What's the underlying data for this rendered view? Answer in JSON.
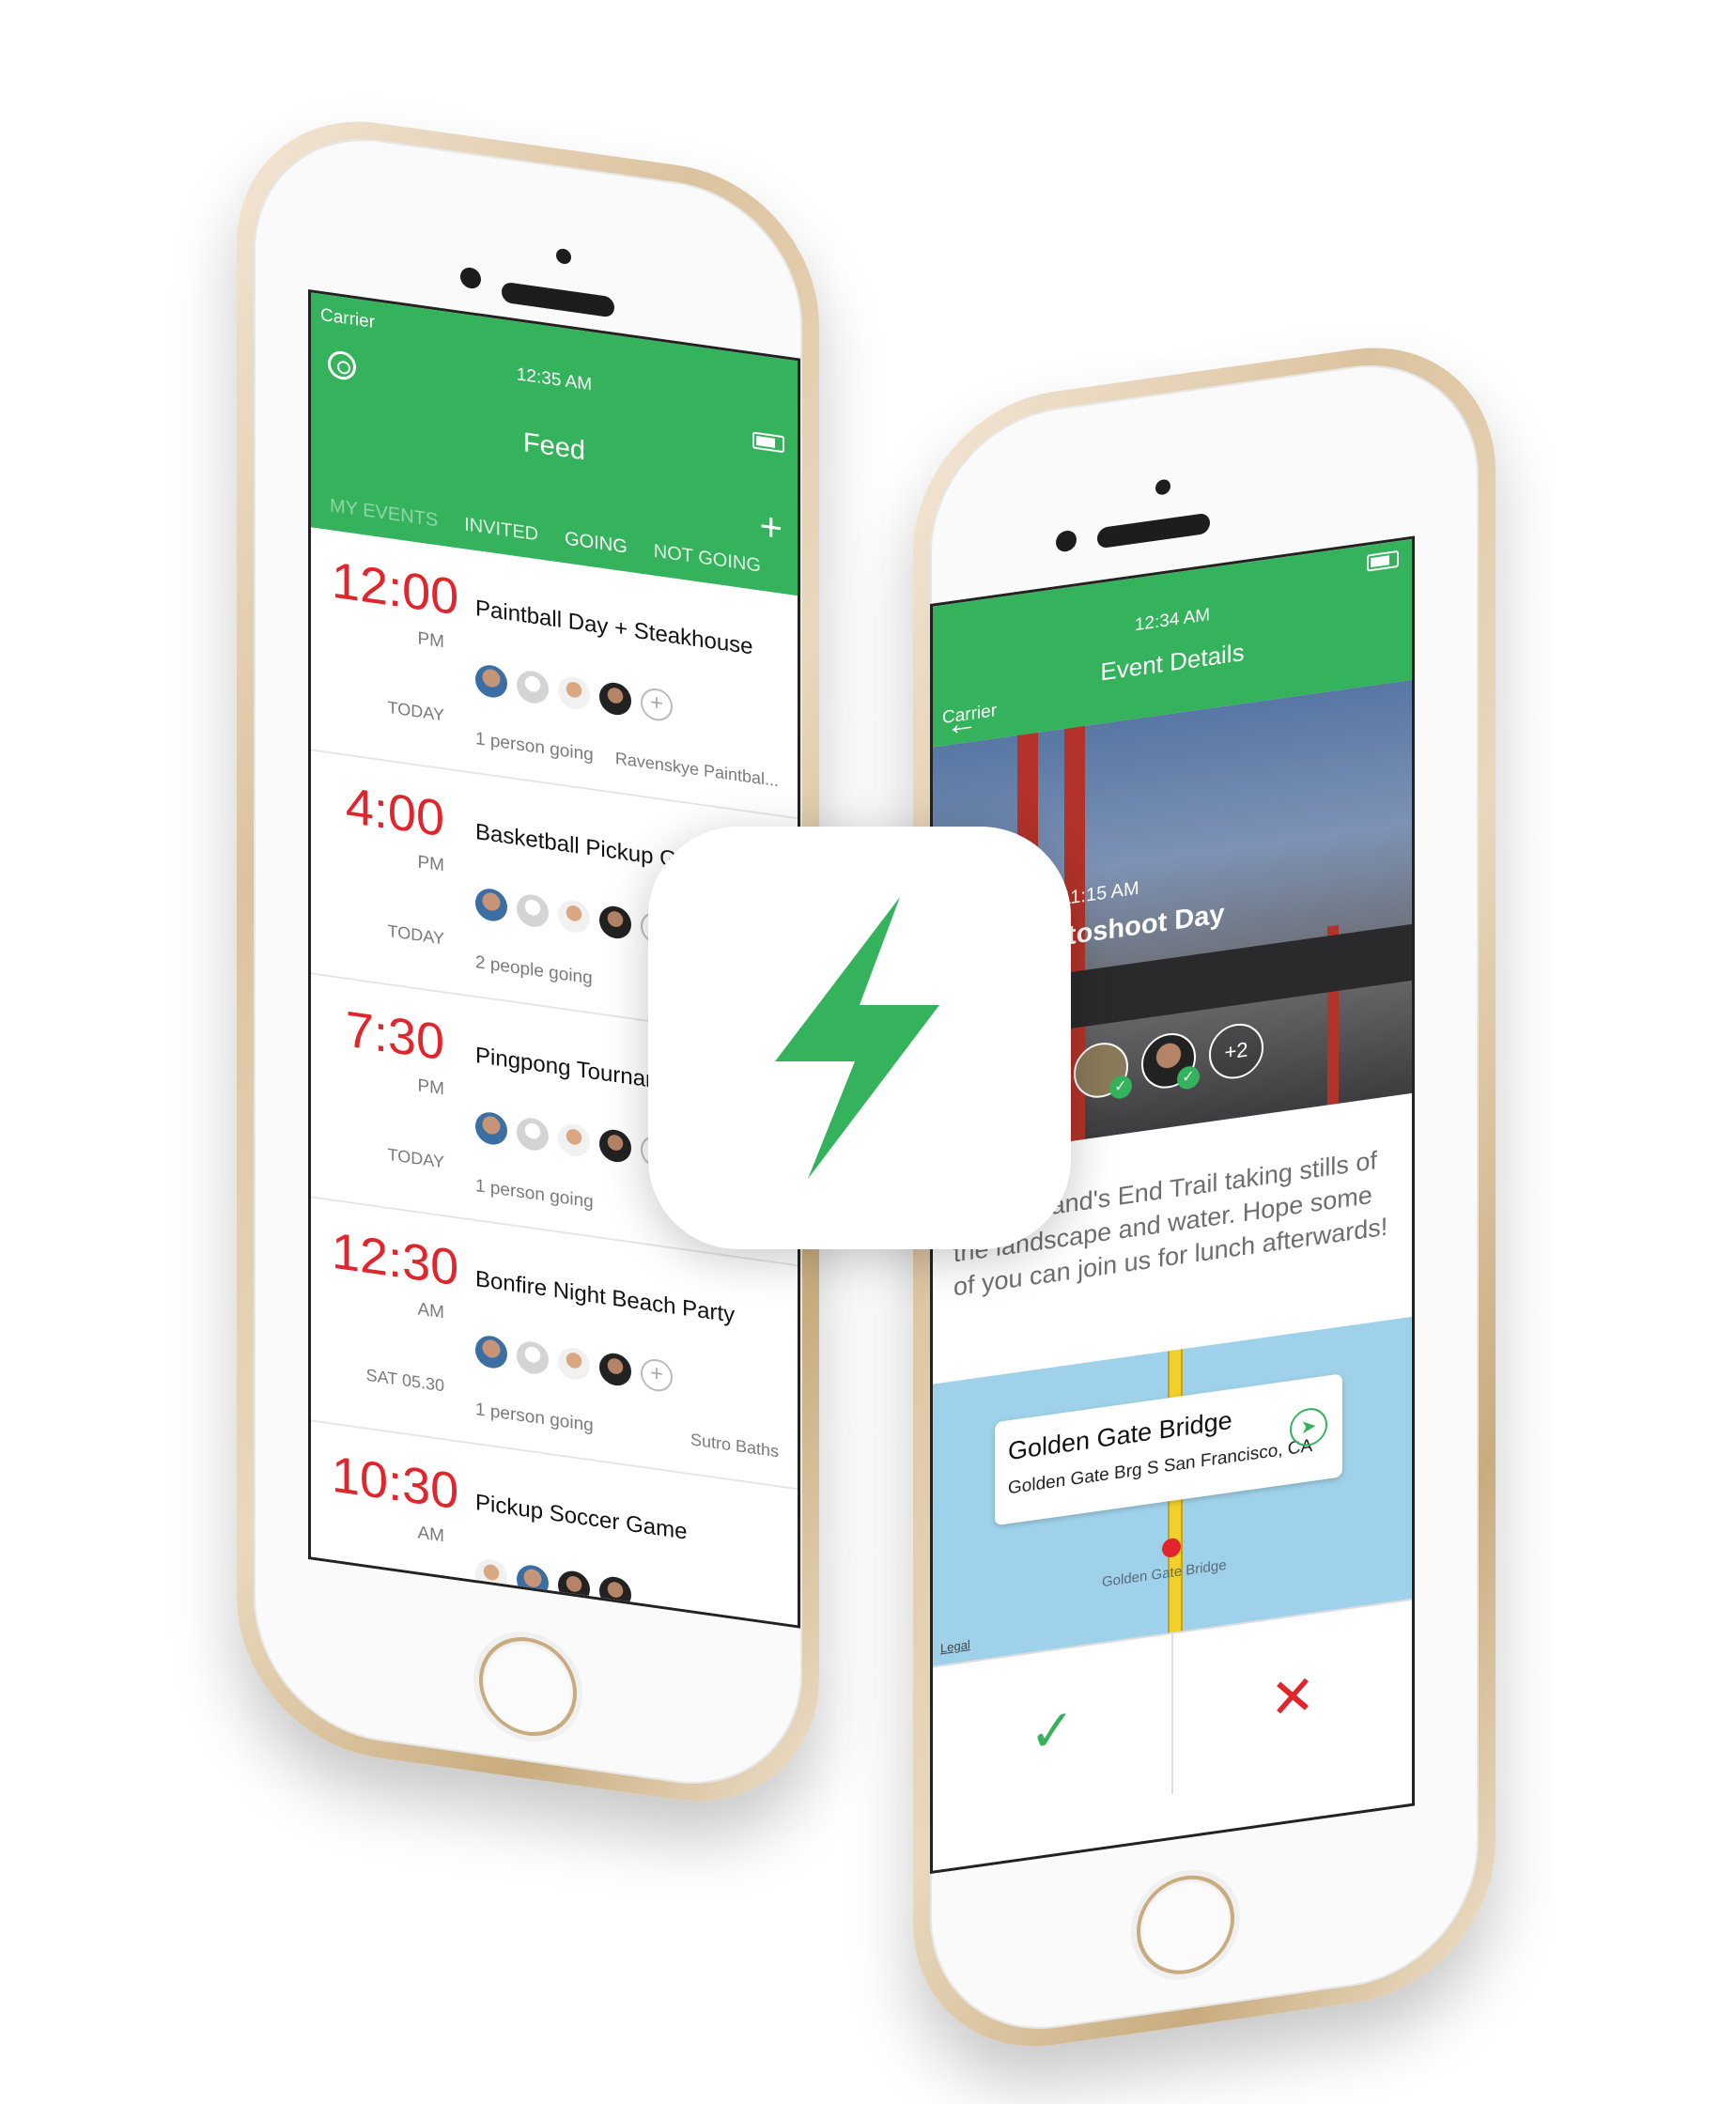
{
  "colors": {
    "brand_green": "#35b35c",
    "time_red": "#e0262c",
    "gold": "#d9bf97"
  },
  "left_phone": {
    "status": {
      "carrier": "Carrier",
      "time": "12:35 AM"
    },
    "settings_icon": "gear-icon",
    "nav_title": "Feed",
    "add_icon": "+",
    "tabs": [
      "MY EVENTS",
      "INVITED",
      "GOING",
      "NOT GOING"
    ],
    "events": [
      {
        "time": "12:00",
        "ampm": "PM",
        "day": "TODAY",
        "title": "Paintball Day + Steakhouse",
        "going": "1 person going",
        "location": "Ravenskye Paintbal..."
      },
      {
        "time": "4:00",
        "ampm": "PM",
        "day": "TODAY",
        "title": "Basketball Pickup Game",
        "going": "2 people going",
        "location": "Ap"
      },
      {
        "time": "7:30",
        "ampm": "PM",
        "day": "TODAY",
        "title": "Pingpong Tourname",
        "going": "1 person going",
        "location": ""
      },
      {
        "time": "12:30",
        "ampm": "AM",
        "day": "SAT 05.30",
        "title": "Bonfire Night Beach Party",
        "going": "1 person going",
        "location": "Sutro Baths"
      },
      {
        "time": "10:30",
        "ampm": "AM",
        "day": "",
        "title": "Pickup Soccer Game",
        "going": "",
        "location": ""
      }
    ],
    "add_person": "+"
  },
  "right_phone": {
    "status": {
      "carrier": "Carrier",
      "time": "12:34 AM"
    },
    "back_icon": "←",
    "nav_title": "Event Details",
    "hero": {
      "date": "SUN MAY 31 11:15 AM",
      "title": "cape Photoshoot Day",
      "more_count": "+2"
    },
    "description": "ing the Land's End Trail taking stills of the landscape and water. Hope some of you can join us for lunch afterwards!",
    "map": {
      "place": "Golden Gate Bridge",
      "address": "Golden Gate Brg S San Francisco, CA",
      "label": "Golden Gate Bridge",
      "legal": "Legal",
      "nav_icon": "➤"
    },
    "accept_icon": "✓",
    "decline_icon": "✕"
  },
  "app_icon": {
    "symbol": "lightning-bolt-icon"
  }
}
